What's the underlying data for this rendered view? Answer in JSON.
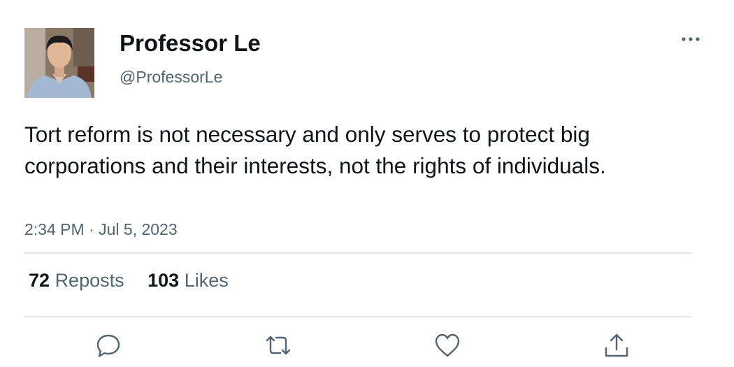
{
  "author": {
    "display_name": "Professor Le",
    "handle": "@ProfessorLe",
    "avatar_icon": "profile-photo"
  },
  "tweet": {
    "text": "Tort reform is not necessary and only serves to protect big corporations and their interests, not the rights of individuals.",
    "timestamp": "2:34 PM · Jul 5, 2023"
  },
  "stats": {
    "reposts_count": "72",
    "reposts_label": "Reposts",
    "likes_count": "103",
    "likes_label": "Likes"
  },
  "actions": [
    {
      "name": "reply",
      "icon": "speech-bubble-icon"
    },
    {
      "name": "repost",
      "icon": "repost-arrows-icon"
    },
    {
      "name": "like",
      "icon": "heart-icon"
    },
    {
      "name": "share",
      "icon": "share-upload-icon"
    }
  ],
  "colors": {
    "text_primary": "#0f1419",
    "text_secondary": "#536471",
    "divider": "#e1e4e8"
  }
}
